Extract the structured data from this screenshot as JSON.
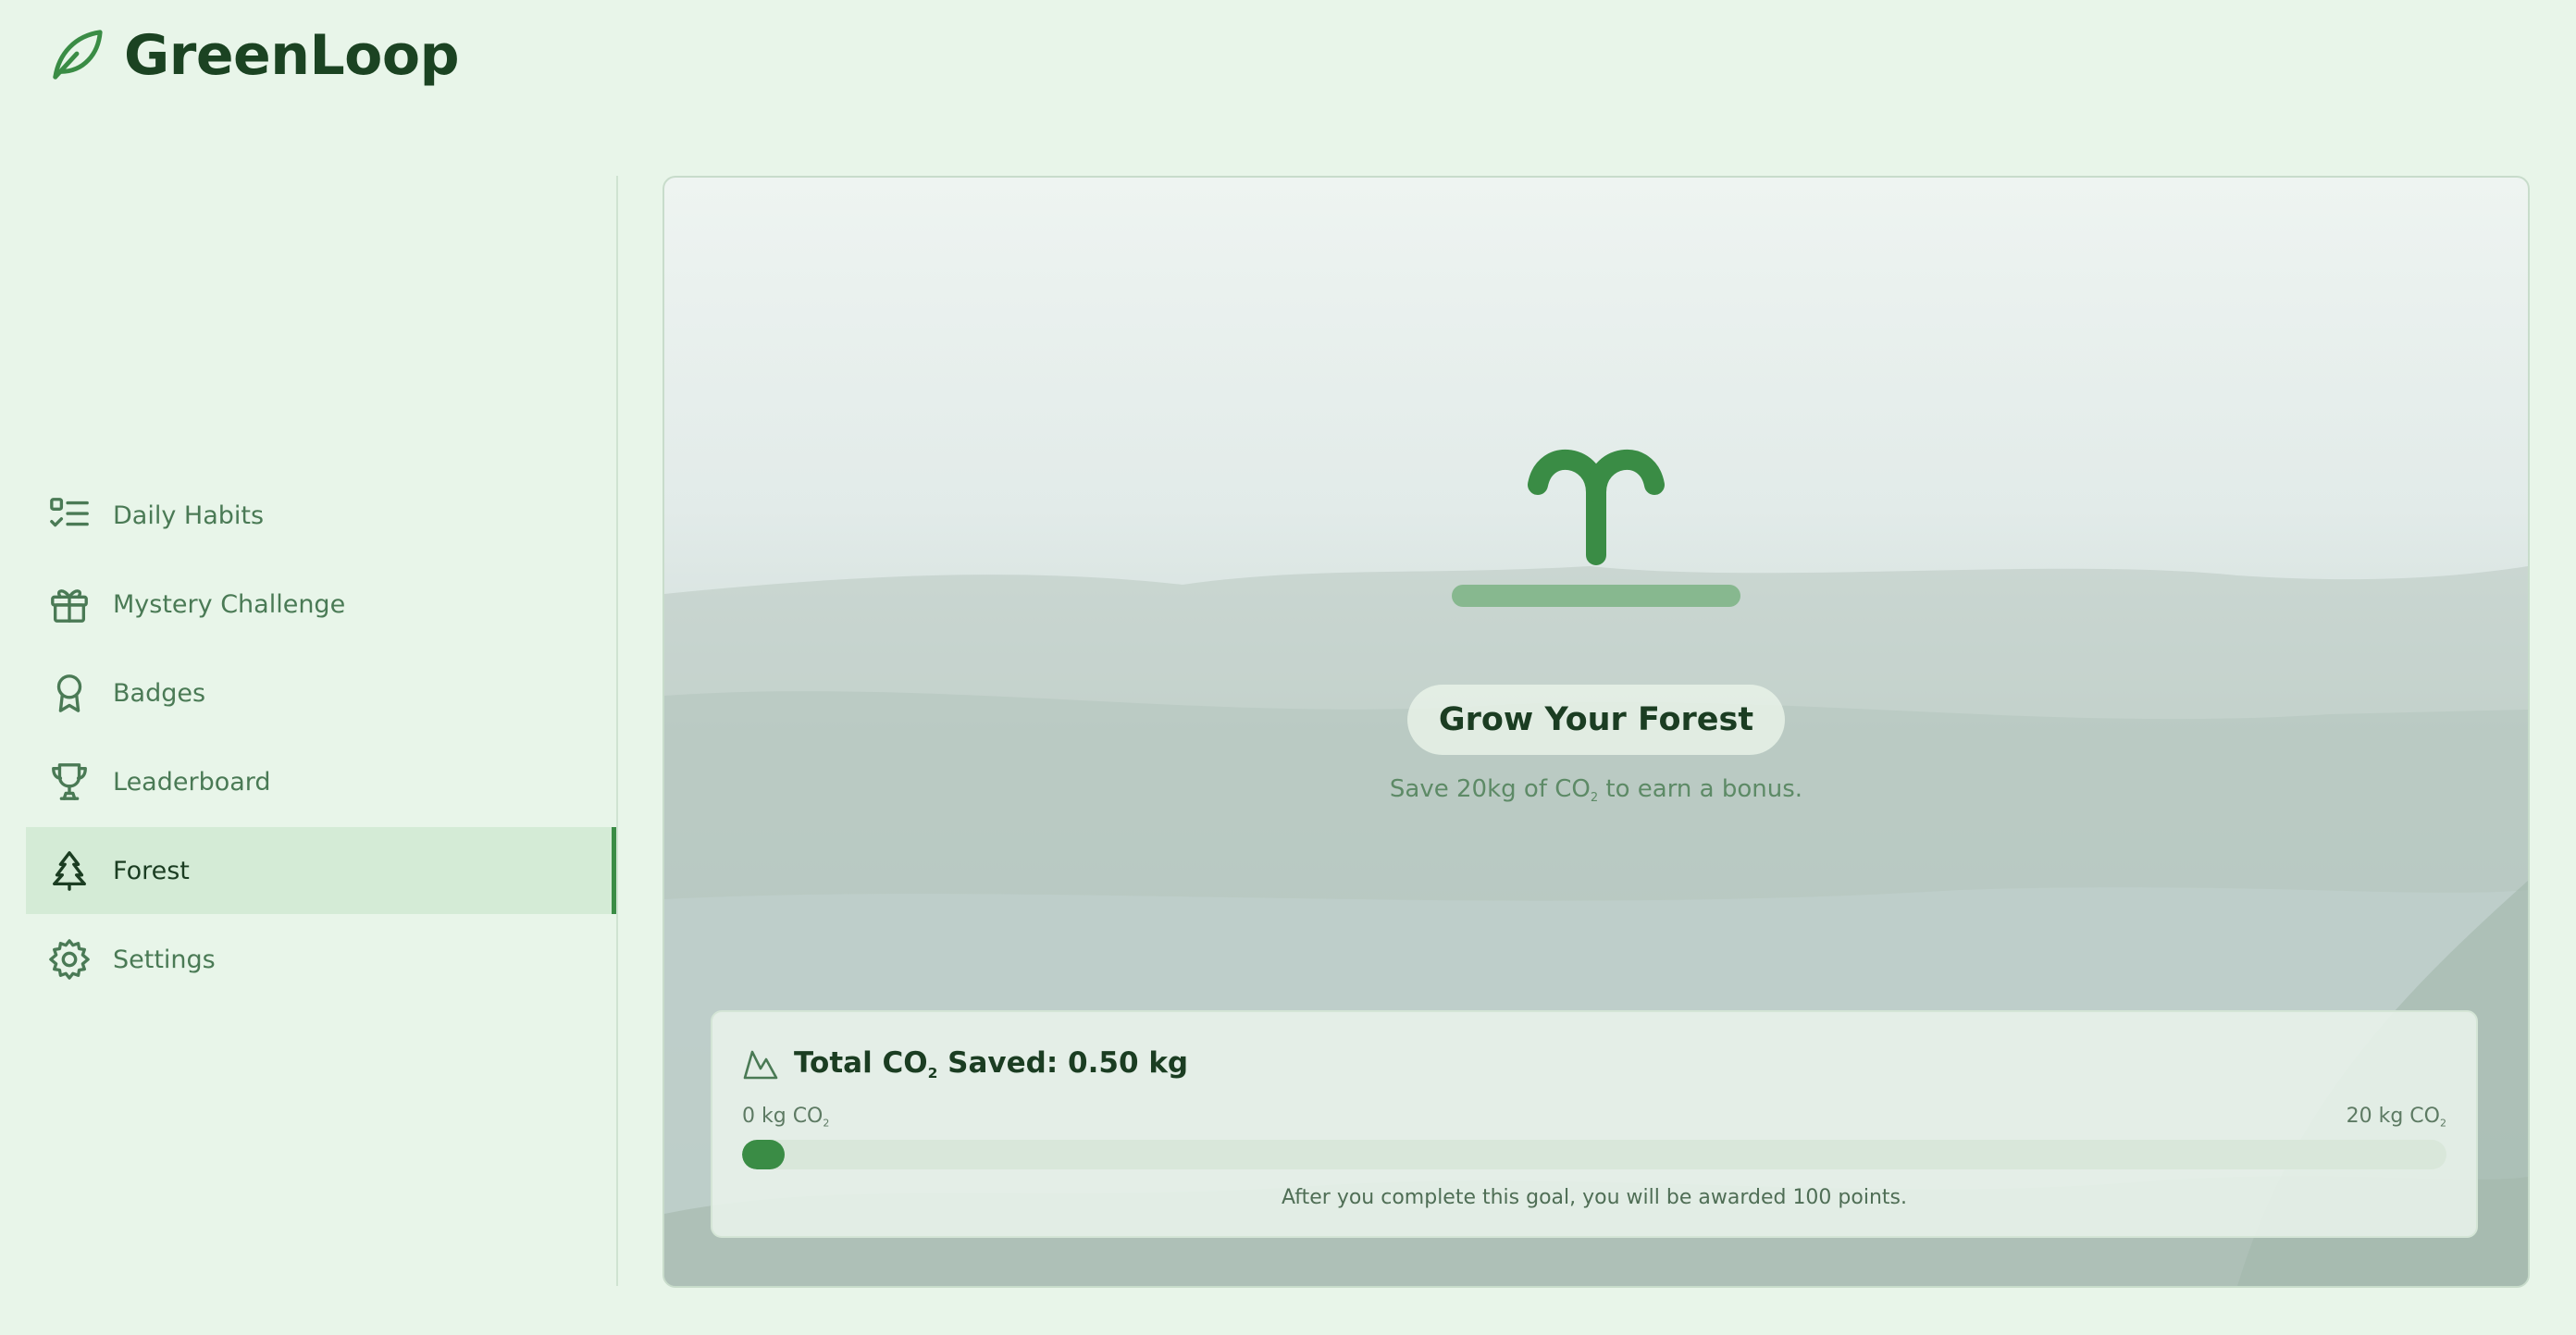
{
  "brand": {
    "name": "GreenLoop",
    "logo_icon": "leaf-icon"
  },
  "sidebar": {
    "items": [
      {
        "label": "Daily Habits",
        "icon": "checklist-icon",
        "active": false
      },
      {
        "label": "Mystery Challenge",
        "icon": "gift-icon",
        "active": false
      },
      {
        "label": "Badges",
        "icon": "badge-ribbon-icon",
        "active": false
      },
      {
        "label": "Leaderboard",
        "icon": "trophy-icon",
        "active": false
      },
      {
        "label": "Forest",
        "icon": "tree-icon",
        "active": true
      },
      {
        "label": "Settings",
        "icon": "gear-icon",
        "active": false
      }
    ]
  },
  "forest": {
    "sprout_icon": "sprout-icon",
    "title": "Grow Your Forest",
    "subtitle_pre": "Save 20kg of CO",
    "subtitle_sub": "2",
    "subtitle_post": " to earn a bonus."
  },
  "progress": {
    "icon": "mountain-icon",
    "title_pre": "Total CO",
    "title_sub": "2",
    "title_post": " Saved: 0.50 kg",
    "min_label": "0 kg CO",
    "max_label": "20 kg CO",
    "label_sub": "2",
    "saved_kg": 0.5,
    "goal_kg": 20,
    "note": "After you complete this goal, you will be awarded 100 points."
  },
  "colors": {
    "accent": "#3a8c45",
    "background": "#e8f5e9",
    "active_item": "#d4ebd6"
  }
}
